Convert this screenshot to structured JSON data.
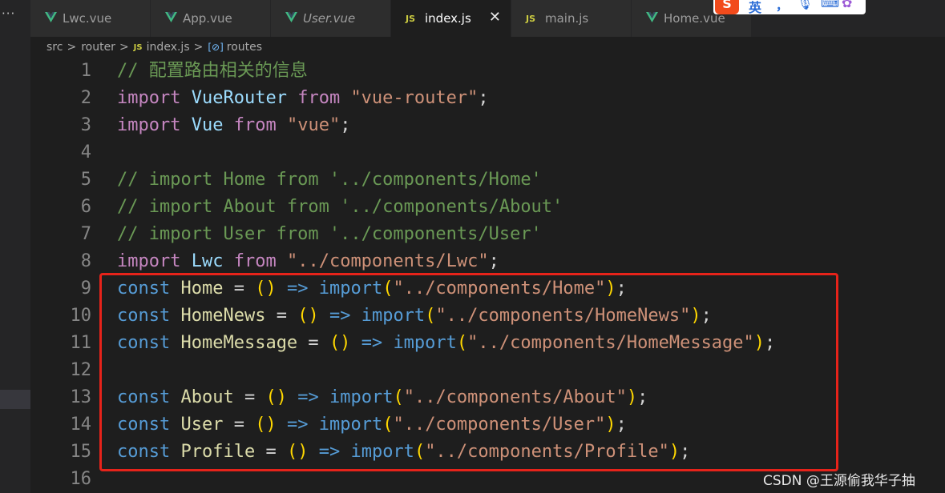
{
  "tabs": [
    {
      "label": "Lwc.vue",
      "icon": "vue-icon",
      "active": false,
      "italic": false
    },
    {
      "label": "App.vue",
      "icon": "vue-icon",
      "active": false,
      "italic": false
    },
    {
      "label": "User.vue",
      "icon": "vue-icon",
      "active": false,
      "italic": true
    },
    {
      "label": "index.js",
      "icon": "js-icon",
      "active": true,
      "italic": false
    },
    {
      "label": "main.js",
      "icon": "js-icon",
      "active": false,
      "italic": false
    },
    {
      "label": "Home.vue",
      "icon": "vue-icon",
      "active": false,
      "italic": false
    }
  ],
  "js_badge": "JS",
  "close_glyph": "✕",
  "more_glyph": "···",
  "ime": {
    "logo": "S",
    "mode": "英",
    "p1": "，",
    "p2": "🎙",
    "p3": "⌨",
    "p4": "✿"
  },
  "breadcrumb": {
    "items": [
      "src",
      "router",
      "index.js",
      "routes"
    ],
    "separator": ">",
    "symbol_icon": "[⊘]"
  },
  "code": {
    "line_numbers": [
      "1",
      "2",
      "3",
      "4",
      "5",
      "6",
      "7",
      "8",
      "9",
      "10",
      "11",
      "12",
      "13",
      "14",
      "15",
      "16"
    ]
  },
  "watermark": "CSDN @王源偷我华子抽",
  "colors": {
    "background": "#1e1e1e",
    "keyword": "#c586c0",
    "string": "#ce9178",
    "comment": "#6a9955",
    "highlight_box": "#e6231a"
  }
}
